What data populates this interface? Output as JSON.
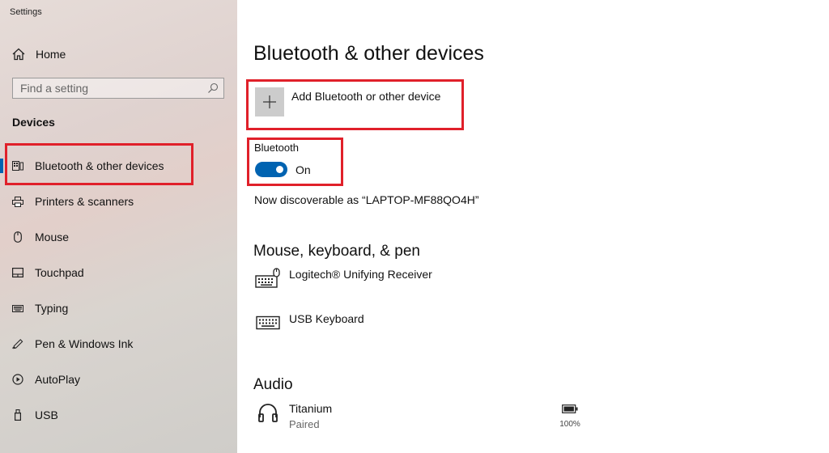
{
  "window": {
    "title": "Settings"
  },
  "sidebar": {
    "home_label": "Home",
    "search_placeholder": "Find a setting",
    "section": "Devices",
    "items": [
      {
        "label": "Bluetooth & other devices",
        "icon": "bluetooth-devices-icon",
        "selected": true
      },
      {
        "label": "Printers & scanners",
        "icon": "printer-icon"
      },
      {
        "label": "Mouse",
        "icon": "mouse-icon"
      },
      {
        "label": "Touchpad",
        "icon": "touchpad-icon"
      },
      {
        "label": "Typing",
        "icon": "keyboard-icon"
      },
      {
        "label": "Pen & Windows Ink",
        "icon": "pen-icon"
      },
      {
        "label": "AutoPlay",
        "icon": "autoplay-icon"
      },
      {
        "label": "USB",
        "icon": "usb-icon"
      }
    ]
  },
  "main": {
    "title": "Bluetooth & other devices",
    "add_device_label": "Add Bluetooth or other device",
    "bluetooth_label": "Bluetooth",
    "bluetooth_state": "On",
    "discoverable_text": "Now discoverable as “LAPTOP-MF88QO4H”",
    "input_section": {
      "title": "Mouse, keyboard, & pen",
      "devices": [
        {
          "name": "Logitech® Unifying Receiver",
          "icon": "keyboard-mouse-icon"
        },
        {
          "name": "USB Keyboard",
          "icon": "keyboard-icon"
        }
      ]
    },
    "audio_section": {
      "title": "Audio",
      "devices": [
        {
          "name": "Titanium",
          "status": "Paired",
          "battery": "100%",
          "icon": "headphones-icon"
        }
      ]
    }
  },
  "colors": {
    "accent": "#0063b1",
    "highlight_box": "#e0202a"
  }
}
